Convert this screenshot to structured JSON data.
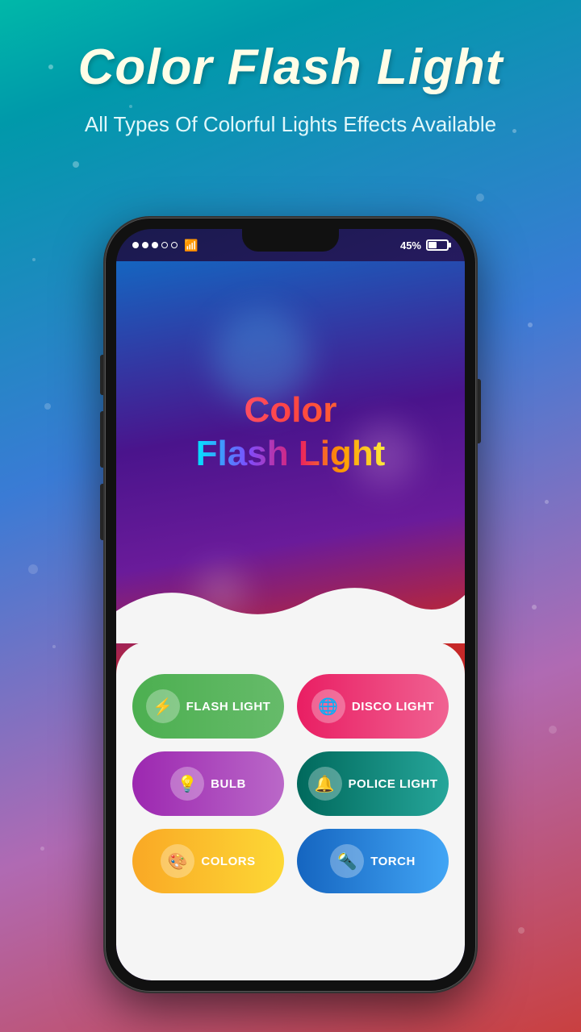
{
  "page": {
    "title": "Color Flash Light",
    "subtitle": "All Types Of Colorful Lights Effects Available",
    "background": {
      "gradient_start": "#00b8a9",
      "gradient_end": "#c94040"
    }
  },
  "header": {
    "title": "Color Flash Light",
    "subtitle": "All Types Of Colorful Lights Effects Available"
  },
  "status_bar": {
    "battery_percent": "45%",
    "signal_dots": [
      "filled",
      "filled",
      "filled",
      "empty",
      "empty"
    ]
  },
  "app_screen": {
    "title_line1": "Color",
    "title_line2_word1": "Flash ",
    "title_line2_word2": "Light"
  },
  "buttons": [
    {
      "id": "flash-light",
      "label": "Flash Light",
      "icon": "⚡",
      "style": "flash"
    },
    {
      "id": "disco-light",
      "label": "DISCO LIGHT",
      "icon": "🌐",
      "style": "disco"
    },
    {
      "id": "bulb",
      "label": "Bulb",
      "icon": "💡",
      "style": "bulb"
    },
    {
      "id": "police-light",
      "label": "POLICE LIGHT",
      "icon": "🔔",
      "style": "police"
    },
    {
      "id": "colors",
      "label": "Colors",
      "icon": "🎨",
      "style": "colors"
    },
    {
      "id": "torch",
      "label": "TORCH",
      "icon": "🔦",
      "style": "torch"
    }
  ]
}
